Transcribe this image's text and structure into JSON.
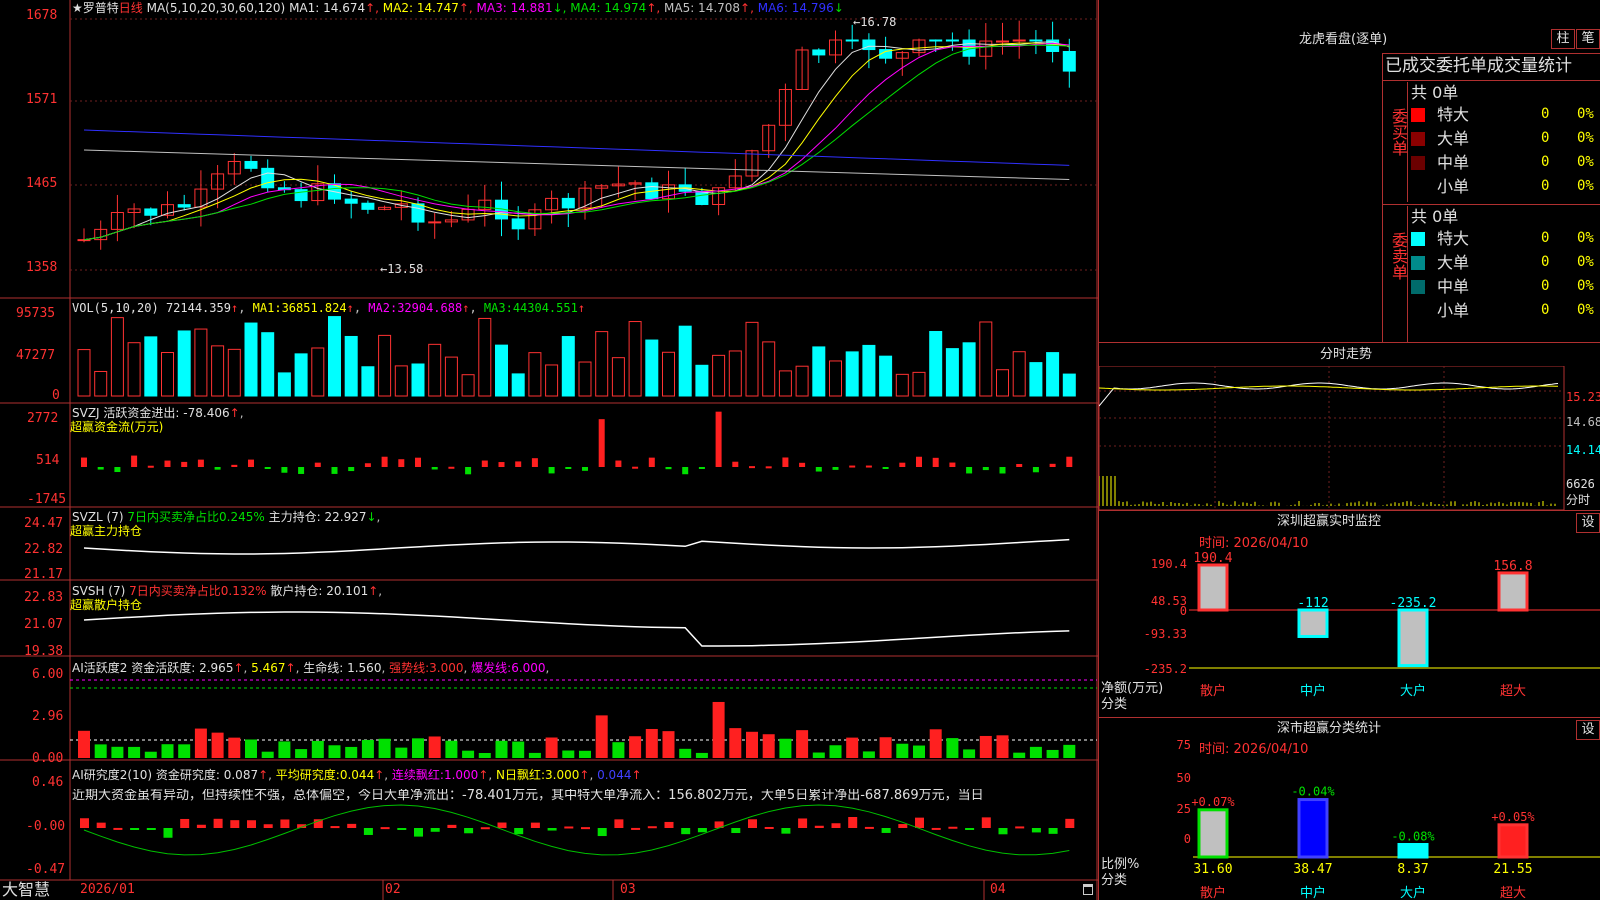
{
  "stock": {
    "name": "★罗普特",
    "period": "日线"
  },
  "main_panel": {
    "ma_label": "MA(5,10,20,30,60,120)",
    "ma": [
      {
        "label": "MA1:",
        "value": "14.674",
        "arrow": "↑",
        "color": "#e0e0e0"
      },
      {
        "label": "MA2:",
        "value": "14.747",
        "arrow": "↑",
        "color": "#ffff00"
      },
      {
        "label": "MA3:",
        "value": "14.881",
        "arrow": "↓",
        "color": "#ff00ff"
      },
      {
        "label": "MA4:",
        "value": "14.974",
        "arrow": "↑",
        "color": "#00e000"
      },
      {
        "label": "MA5:",
        "value": "14.708",
        "arrow": "↑",
        "color": "#c0c0c0"
      },
      {
        "label": "MA6:",
        "value": "14.796",
        "arrow": "↓",
        "color": "#3030ff"
      }
    ],
    "y_ticks": [
      "1678",
      "1571",
      "1465",
      "1358"
    ],
    "high_mark": "16.78",
    "low_mark": "13.58"
  },
  "vol_panel": {
    "title": "VOL(5,10,20)",
    "value": "72144.359",
    "ma1": "36851.824",
    "ma2": "32904.688",
    "ma3": "44304.551",
    "ma1_label": "MA1:",
    "ma2_label": "MA2:",
    "ma3_label": "MA3:",
    "y_ticks": [
      "95735",
      "47277",
      "0"
    ]
  },
  "svzj_panel": {
    "title": "SVZJ",
    "label": "活跃资金进出:",
    "value": "-78.406",
    "subtitle": "超赢资金流(万元)",
    "y_ticks": [
      "2772",
      "514",
      "-1745"
    ]
  },
  "svzl_panel": {
    "title": "SVZL (7)",
    "ratio": "7日内买卖净占比0.245%",
    "label": "主力持仓:",
    "value": "22.927",
    "subtitle": "超赢主力持仓",
    "y_ticks": [
      "24.47",
      "22.82",
      "21.17"
    ]
  },
  "svsh_panel": {
    "title": "SVSH (7)",
    "ratio": "7日内买卖净占比0.132%",
    "label": "散户持仓:",
    "value": "20.101",
    "subtitle": "超赢散户持仓",
    "y_ticks": [
      "22.83",
      "21.07",
      "19.38"
    ]
  },
  "ai_active_panel": {
    "title": "AI活跃度2",
    "label": "资金活跃度:",
    "value1": "2.965",
    "value2": "5.467",
    "life_label": "生命线:",
    "life": "1.560",
    "strong_label": "强势线:",
    "strong": "3.000",
    "burst_label": "爆发线:",
    "burst": "6.000",
    "y_ticks": [
      "6.00",
      "2.96",
      "0.00"
    ]
  },
  "ai_research_panel": {
    "title": "AI研究度2(10)",
    "label": "资金研究度:",
    "value": "0.087",
    "avg_label": "平均研究度:",
    "avg": "0.044",
    "cont_label": "连续飘红:",
    "cont": "1.000",
    "n_label": "N日飘红:",
    "n": "3.000",
    "last": "0.044",
    "commentary": "近期大资金虽有异动，但持续性不强，总体偏空，今日大单净流出：-78.401万元，其中特大单净流入：156.802万元，大单5日累计净出-687.869万元，当日",
    "y_ticks": [
      "0.46",
      "-0.00",
      "-0.47"
    ]
  },
  "x_axis": {
    "labels": [
      "2026/01",
      "02",
      "03",
      "04"
    ],
    "brand": "大智慧"
  },
  "right_panel": {
    "lhb_title": "龙虎看盘(逐单)",
    "btn_column": "柱",
    "btn_pen": "笔",
    "stats_title": "已成交委托单成交量统计",
    "buy_side": "委买单",
    "sell_side": "委卖单",
    "buy_total": "共 0单",
    "sell_total": "共 0单",
    "buy_rows": [
      {
        "label": "特大",
        "count": "0",
        "pct": "0%",
        "color": "#ff0000"
      },
      {
        "label": "大单",
        "count": "0",
        "pct": "0%",
        "color": "#8b0000"
      },
      {
        "label": "中单",
        "count": "0",
        "pct": "0%",
        "color": "#6b0000"
      },
      {
        "label": "小单",
        "count": "0",
        "pct": "0%",
        "color": ""
      }
    ],
    "sell_rows": [
      {
        "label": "特大",
        "count": "0",
        "pct": "0%",
        "color": "#00ffff"
      },
      {
        "label": "大单",
        "count": "0",
        "pct": "0%",
        "color": "#008b8b"
      },
      {
        "label": "中单",
        "count": "0",
        "pct": "0%",
        "color": "#006b6b"
      },
      {
        "label": "小单",
        "count": "0",
        "pct": "0%",
        "color": ""
      }
    ],
    "intraday_title": "分时走势",
    "intraday_ticks": [
      "15.23",
      "14.68",
      "14.14",
      "6626",
      "分时"
    ],
    "monitor_title": "深圳超赢实时监控",
    "monitor_btn": "设",
    "monitor_time": "时间: 2026/04/10",
    "monitor_yticks": [
      "190.4",
      "48.53",
      "0",
      "-93.33",
      "-235.2"
    ],
    "monitor_ylabel": "净额(万元)",
    "monitor_xlabel": "分类",
    "monitor_bars": [
      {
        "cat": "散户",
        "value": "190.4",
        "num": 190.4,
        "type": "retail"
      },
      {
        "cat": "中户",
        "value": "-112",
        "num": -112,
        "type": "mid"
      },
      {
        "cat": "大户",
        "value": "-235.2",
        "num": -235.2,
        "type": "big"
      },
      {
        "cat": "超大",
        "value": "156.8",
        "num": 156.8,
        "type": "huge"
      }
    ],
    "class_title": "深市超赢分类统计",
    "class_btn": "设",
    "class_time": "时间: 2026/04/10",
    "class_yticks": [
      "75",
      "50",
      "25",
      "0"
    ],
    "class_ylabel": "比例%",
    "class_xlabel": "分类",
    "class_bars": [
      {
        "cat": "散户",
        "value": "31.60",
        "num": 31.6,
        "change": "+0.07%"
      },
      {
        "cat": "中户",
        "value": "38.47",
        "num": 38.47,
        "change": "-0.04%"
      },
      {
        "cat": "大户",
        "value": "8.37",
        "num": 8.37,
        "change": "-0.08%"
      },
      {
        "cat": "超大",
        "value": "21.55",
        "num": 21.55,
        "change": "+0.05%"
      }
    ]
  }
}
